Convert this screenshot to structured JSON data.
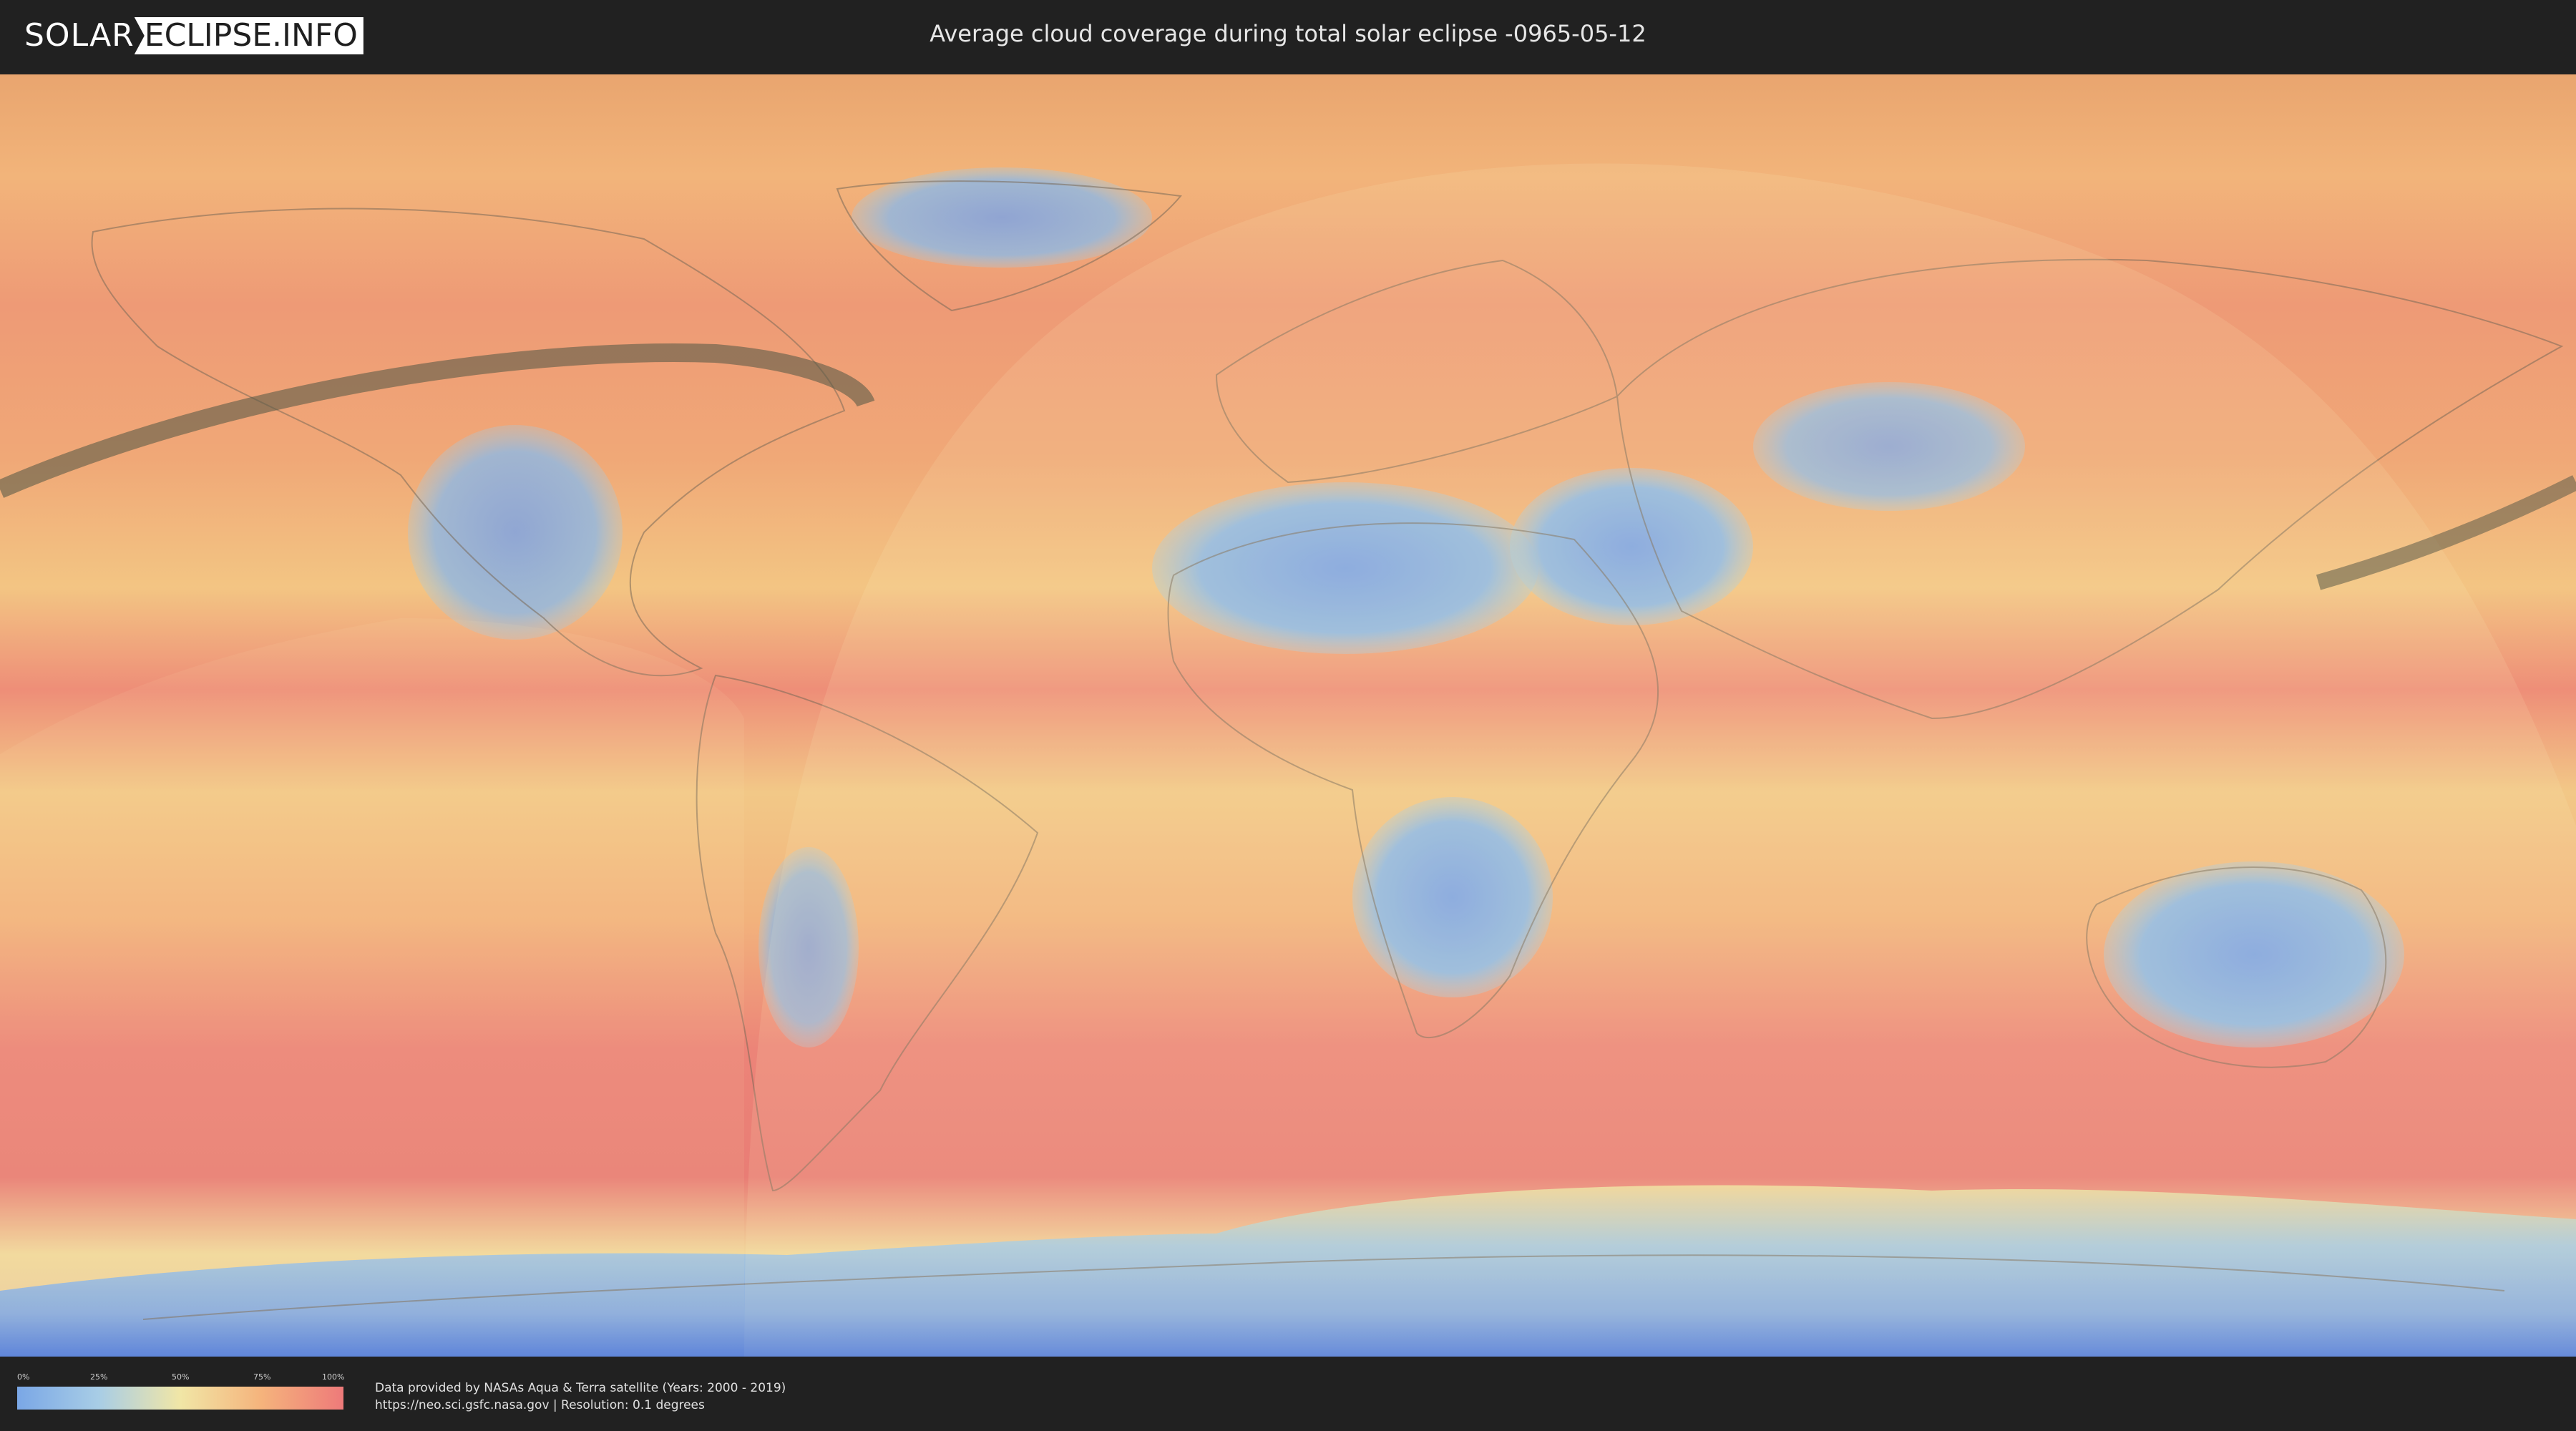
{
  "header": {
    "logo_left": "SOLAR",
    "logo_right": "ECLIPSE.INFO",
    "title": "Average cloud coverage during total solar eclipse -0965-05-12"
  },
  "legend": {
    "ticks": [
      "0%",
      "25%",
      "50%",
      "75%",
      "100%"
    ],
    "colors": [
      "#7aa7e6",
      "#a8cde6",
      "#f1e6a6",
      "#f5b37c",
      "#ee7a7a"
    ]
  },
  "credits": {
    "line1": "Data provided by NASAs Aqua & Terra satellite (Years: 2000 - 2019)",
    "line2": "https://neo.sci.gsfc.nasa.gov | Resolution: 0.1 degrees"
  },
  "map": {
    "colors": {
      "ocean_high": "#ec8478",
      "ocean_mid": "#f2b27c",
      "low_cloud": "#f1e0a0",
      "clear": "#7fa8e2",
      "clear_deep": "#4b79e0",
      "coastline": "#7a6a58",
      "path": "#5b5b48"
    }
  }
}
